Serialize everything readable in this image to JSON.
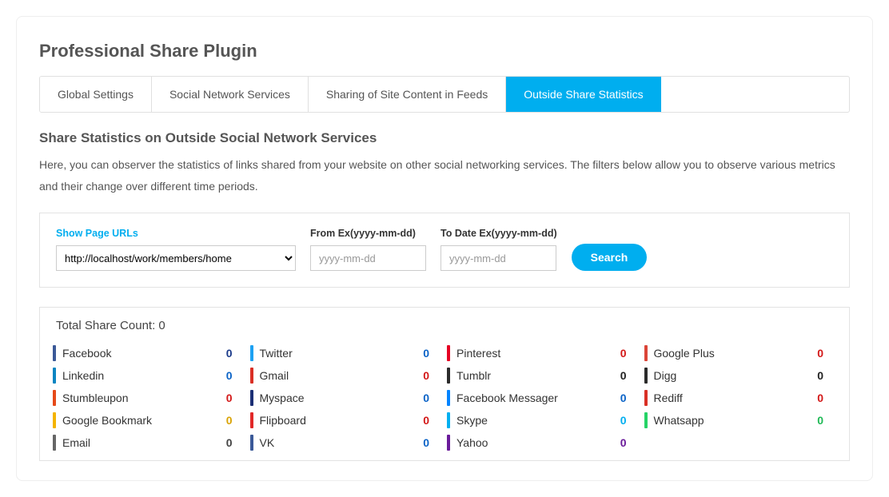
{
  "page_title": "Professional Share Plugin",
  "tabs": [
    {
      "label": "Global Settings",
      "active": false
    },
    {
      "label": "Social Network Services",
      "active": false
    },
    {
      "label": "Sharing of Site Content in Feeds",
      "active": false
    },
    {
      "label": "Outside Share Statistics",
      "active": true
    }
  ],
  "section": {
    "title": "Share Statistics on Outside Social Network Services",
    "desc": "Here, you can observer the statistics of links shared from your website on other social networking services. The filters below allow you to observe various metrics and their change over different time periods."
  },
  "filters": {
    "url_label": "Show Page URLs",
    "url_value": "http://localhost/work/members/home",
    "from_label": "From Ex(yyyy-mm-dd)",
    "from_placeholder": "yyyy-mm-dd",
    "to_label": "To Date Ex(yyyy-mm-dd)",
    "to_placeholder": "yyyy-mm-dd",
    "search_label": "Search"
  },
  "total": {
    "label_prefix": "Total Share Count: ",
    "value": "0"
  },
  "services": [
    {
      "name": "Facebook",
      "count": "0",
      "bar_color": "#3b5998",
      "count_color": "#1a3a8a"
    },
    {
      "name": "Twitter",
      "count": "0",
      "bar_color": "#1da1f2",
      "count_color": "#0b63c7"
    },
    {
      "name": "Pinterest",
      "count": "0",
      "bar_color": "#e60023",
      "count_color": "#d31818"
    },
    {
      "name": "Google Plus",
      "count": "0",
      "bar_color": "#db4437",
      "count_color": "#d31818"
    },
    {
      "name": "Linkedin",
      "count": "0",
      "bar_color": "#0a85c2",
      "count_color": "#0b63c7"
    },
    {
      "name": "Gmail",
      "count": "0",
      "bar_color": "#d93025",
      "count_color": "#d31818"
    },
    {
      "name": "Tumblr",
      "count": "0",
      "bar_color": "#2b2b2b",
      "count_color": "#222"
    },
    {
      "name": "Digg",
      "count": "0",
      "bar_color": "#2b2b2b",
      "count_color": "#222"
    },
    {
      "name": "Stumbleupon",
      "count": "0",
      "bar_color": "#e64a19",
      "count_color": "#d31818"
    },
    {
      "name": "Myspace",
      "count": "0",
      "bar_color": "#1b2f75",
      "count_color": "#0b63c7"
    },
    {
      "name": "Facebook Messager",
      "count": "0",
      "bar_color": "#0084ff",
      "count_color": "#0b63c7"
    },
    {
      "name": "Rediff",
      "count": "0",
      "bar_color": "#d93025",
      "count_color": "#d31818"
    },
    {
      "name": "Google Bookmark",
      "count": "0",
      "bar_color": "#f4b400",
      "count_color": "#d9a304"
    },
    {
      "name": "Flipboard",
      "count": "0",
      "bar_color": "#e12828",
      "count_color": "#d31818"
    },
    {
      "name": "Skype",
      "count": "0",
      "bar_color": "#00aff0",
      "count_color": "#00aeef"
    },
    {
      "name": "Whatsapp",
      "count": "0",
      "bar_color": "#25d366",
      "count_color": "#1fb955"
    },
    {
      "name": "Email",
      "count": "0",
      "bar_color": "#666",
      "count_color": "#444"
    },
    {
      "name": "VK",
      "count": "0",
      "bar_color": "#3b5998",
      "count_color": "#0b63c7"
    },
    {
      "name": "Yahoo",
      "count": "0",
      "bar_color": "#6a1b9a",
      "count_color": "#6a1b9a"
    }
  ]
}
